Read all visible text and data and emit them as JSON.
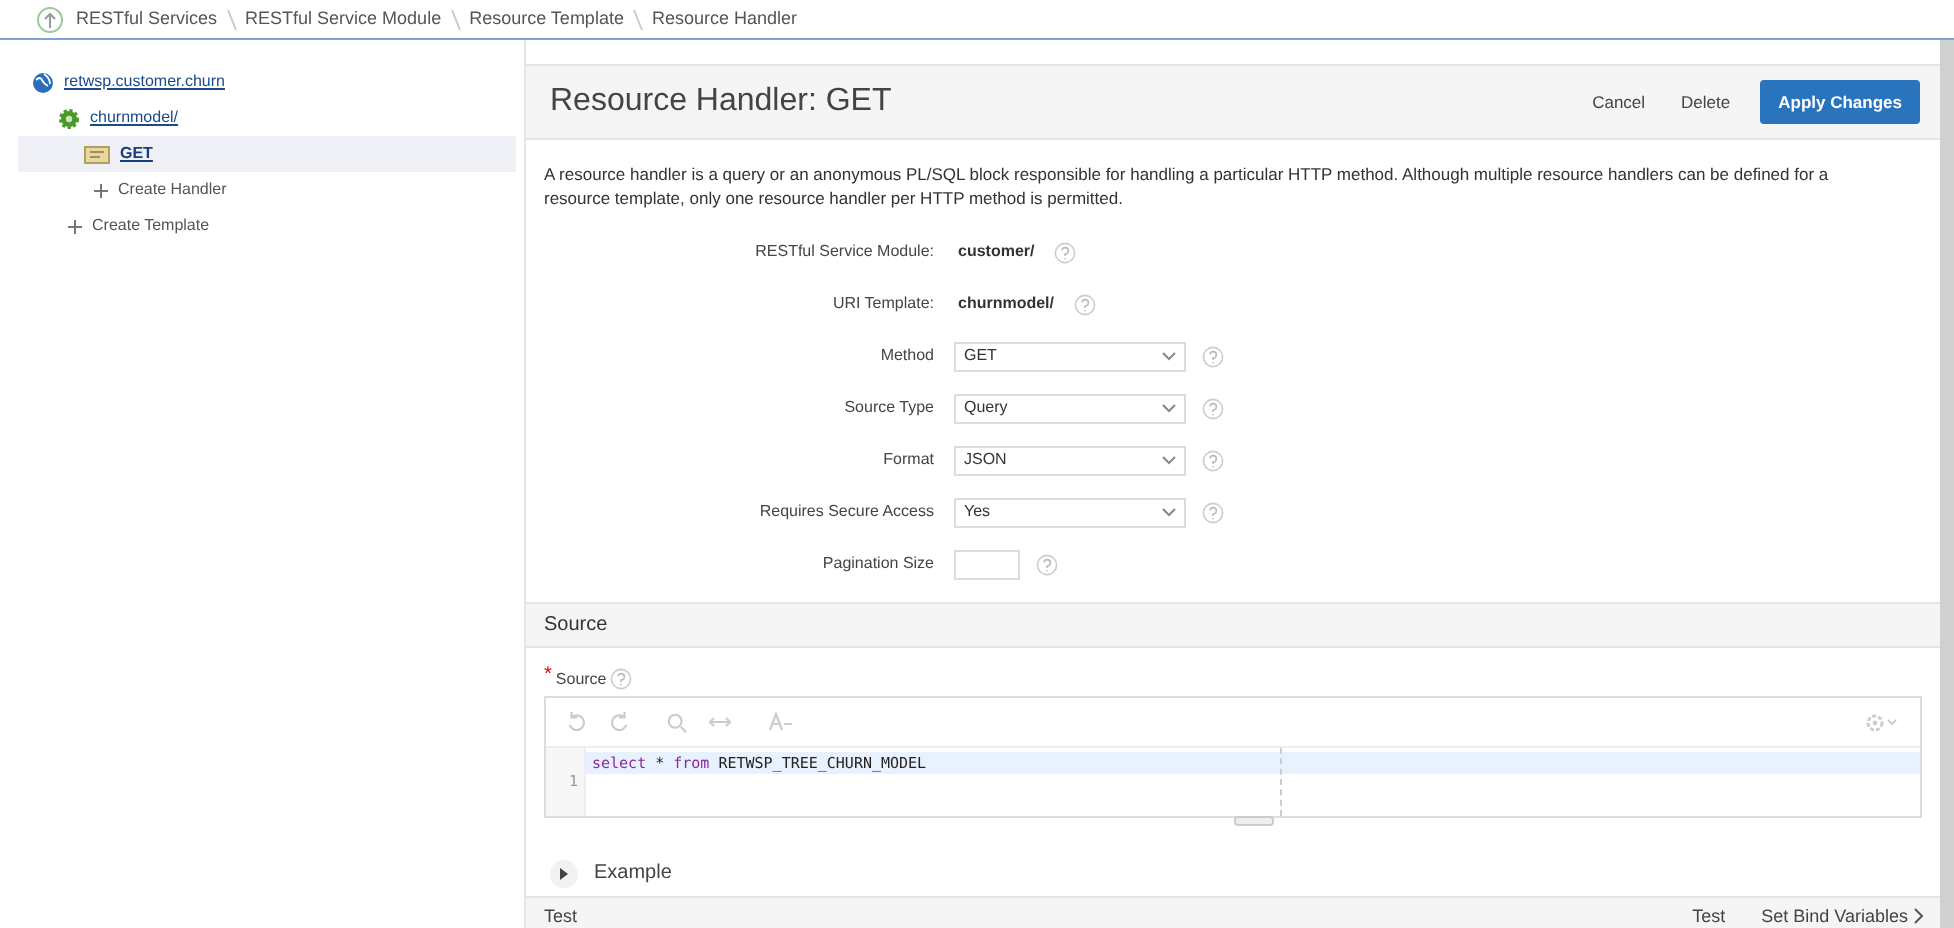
{
  "breadcrumbs": [
    {
      "label": "RESTful Services"
    },
    {
      "label": "RESTful Service Module"
    },
    {
      "label": "Resource Template"
    },
    {
      "label": "Resource Handler"
    }
  ],
  "tree": [
    {
      "kind": "module",
      "label": "retwsp.customer.churn",
      "selected": false,
      "children": [
        {
          "kind": "template",
          "label": "churnmodel/",
          "selected": false,
          "children": [
            {
              "kind": "handler",
              "label": "GET",
              "selected": true
            },
            {
              "kind": "create",
              "label": "Create Handler",
              "selected": false
            }
          ]
        },
        {
          "kind": "create",
          "label": "Create Template",
          "selected": false
        }
      ]
    }
  ],
  "header": {
    "title": "Resource Handler: GET",
    "buttons": [
      {
        "label": "Cancel",
        "kind": "plain"
      },
      {
        "label": "Delete",
        "kind": "plain"
      },
      {
        "label": "Apply Changes",
        "kind": "primary"
      }
    ]
  },
  "description": "A resource handler is a query or an anonymous PL/SQL block responsible for handling a particular HTTP method. Although multiple resource handlers can be defined for a resource template, only one resource handler per HTTP method is permitted.",
  "fields": [
    {
      "kind": "display",
      "label": "RESTful Service Module:",
      "value": "customer/"
    },
    {
      "kind": "display",
      "label": "URI Template:",
      "value": "churnmodel/"
    },
    {
      "kind": "select",
      "label": "Method",
      "value": "GET"
    },
    {
      "kind": "select",
      "label": "Source Type",
      "value": "Query"
    },
    {
      "kind": "select",
      "label": "Format",
      "value": "JSON"
    },
    {
      "kind": "select",
      "label": "Requires Secure Access",
      "value": "Yes"
    },
    {
      "kind": "text",
      "label": "Pagination Size"
    }
  ],
  "source": {
    "title": "Source",
    "field_label": "Source",
    "required": true,
    "line_number": "1",
    "tokens": [
      {
        "kind": "keyword",
        "text": "select"
      },
      {
        "kind": "plain",
        "text": " * "
      },
      {
        "kind": "keyword",
        "text": "from"
      },
      {
        "kind": "plain",
        "text": " RETWSP_TREE_CHURN_MODEL"
      }
    ],
    "example": {
      "label": "Example",
      "expanded": false
    }
  },
  "test": {
    "title": "Test",
    "actions": [
      {
        "label": "Test",
        "kind": "plain"
      },
      {
        "label": "Set Bind Variables",
        "kind": "chevron"
      }
    ]
  }
}
